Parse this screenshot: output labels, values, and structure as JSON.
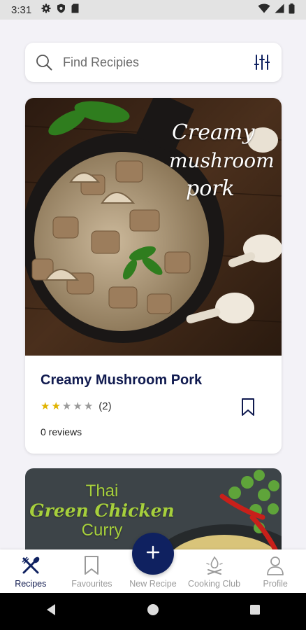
{
  "status_bar": {
    "time": "3:31",
    "icons": [
      "settings-icon",
      "shield-icon",
      "sd-card-icon",
      "wifi-icon",
      "signal-icon",
      "battery-icon"
    ]
  },
  "search": {
    "placeholder": "Find Recipies",
    "icon": "search-icon",
    "filter_icon": "filter-sliders-icon"
  },
  "recipes": [
    {
      "title": "Creamy Mushroom Pork",
      "image_caption": [
        "Creamy",
        "mushroom",
        "pork"
      ],
      "rating": 2,
      "rating_max": 5,
      "rating_count": "(2)",
      "reviews": "0 reviews",
      "bookmark_icon": "bookmark-icon"
    },
    {
      "image_caption": [
        "Thai",
        "Green Chicken",
        "Curry"
      ]
    }
  ],
  "bottom_nav": {
    "items": [
      {
        "label": "Recipes",
        "icon": "utensils-icon",
        "active": true
      },
      {
        "label": "Favourites",
        "icon": "bookmark-icon",
        "active": false
      },
      {
        "label": "New Recipe",
        "icon": "plus-icon",
        "active": false
      },
      {
        "label": "Cooking Club",
        "icon": "campfire-icon",
        "active": false
      },
      {
        "label": "Profile",
        "icon": "person-icon",
        "active": false
      }
    ]
  },
  "colors": {
    "brand_navy": "#0f2160",
    "title_navy": "#101a4f",
    "star_gold": "#e0b300",
    "inactive_gray": "#9a9a9a"
  }
}
